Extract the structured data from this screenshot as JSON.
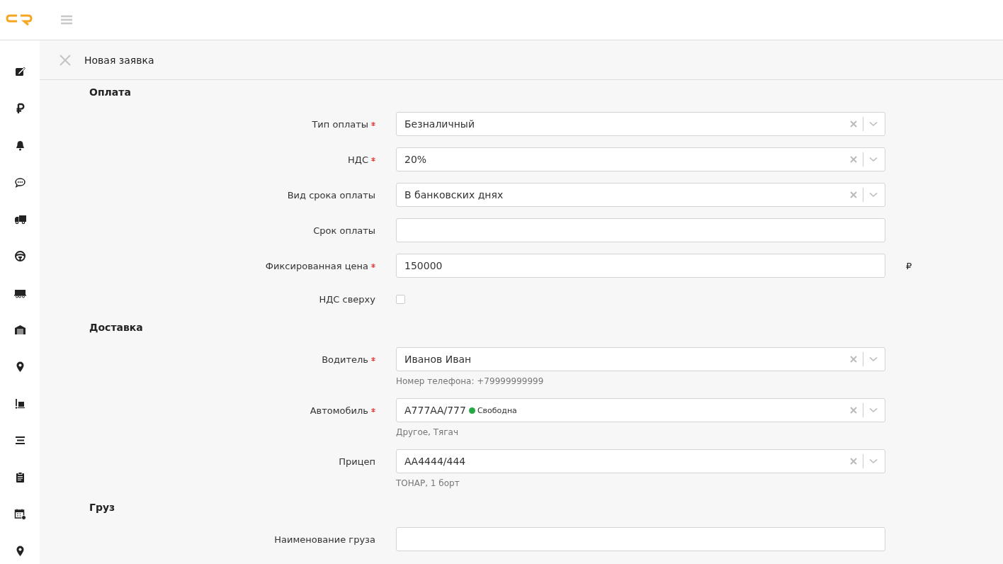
{
  "page": {
    "title": "Новая заявка"
  },
  "sections": [
    {
      "title": "Оплата",
      "fields": [
        {
          "kind": "select",
          "label": "Тип оплаты",
          "required": true,
          "value": "Безналичный"
        },
        {
          "kind": "select",
          "label": "НДС",
          "required": true,
          "value": "20%"
        },
        {
          "kind": "select",
          "label": "Вид срока оплаты",
          "required": false,
          "value": "В банковских днях"
        },
        {
          "kind": "input",
          "label": "Срок оплаты",
          "required": false
        },
        {
          "kind": "input",
          "label": "Фиксированная цена",
          "required": true,
          "value": "150000",
          "unit": "₽"
        },
        {
          "kind": "checkbox",
          "label": "НДС сверху",
          "required": false,
          "checked": false
        }
      ]
    },
    {
      "title": "Доставка",
      "fields": [
        {
          "kind": "select",
          "label": "Водитель",
          "required": true,
          "value": "Иванов Иван",
          "hint": "Номер телефона: +79999999999"
        },
        {
          "kind": "select",
          "label": "Автомобиль",
          "required": true,
          "value": "А777АА/777",
          "status": {
            "text": "Свободна",
            "color": "#28a745"
          },
          "hint": "Другое, Тягач"
        },
        {
          "kind": "select",
          "label": "Прицеп",
          "required": false,
          "value": "АА4444/444",
          "hint": "ТОНАР, 1 борт"
        }
      ]
    },
    {
      "title": "Груз",
      "fields": [
        {
          "kind": "input",
          "label": "Наименование груза",
          "required": false
        }
      ]
    }
  ]
}
